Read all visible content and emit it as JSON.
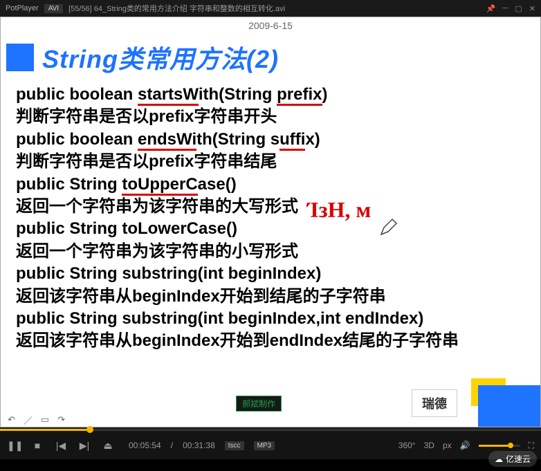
{
  "titlebar": {
    "app": "PotPlayer",
    "format": "AVI",
    "title": "[55/56] 64_String类的常用方法介绍 字符串和整数的相互转化.avi"
  },
  "date": "2009-6-15",
  "slide_title": "String类常用方法(2)",
  "lines": {
    "l1a": "public boolean ",
    "l1b": "startsW",
    "l1c": "ith(String ",
    "l1d": "prefix",
    "l1e": ")",
    "l2": "判断字符串是否以prefix字符串开头",
    "l3a": "public boolean ",
    "l3b": "endsWi",
    "l3c": "th(String s",
    "l3d": "uffi",
    "l3e": "x)",
    "l4": "判断字符串是否以prefix字符串结尾",
    "l5a": "public String ",
    "l5b": "toUpperC",
    "l5c": "ase()",
    "l6": "返回一个字符串为该字符串的大写形式",
    "l7": "public String toLowerCase()",
    "l8": "返回一个字符串为该字符串的小写形式",
    "l9": "public String substring(int beginIndex)",
    "l10": "返回该字符串从beginIndex开始到结尾的子字符串",
    "l11": "public String substring(int beginIndex,int endIndex)",
    "l12": "返回该字符串从beginIndex开始到endIndex结尾的子字符串"
  },
  "annotation": "ΊзΗ, м",
  "credit": "郝斌制作",
  "brand": "瑞德",
  "controls": {
    "play": "❚❚",
    "stop": "■",
    "prev": "|◀",
    "next": "▶|",
    "eject": "⏏",
    "cur": "00:05:54",
    "dur": "00:31:38",
    "codec": "tscc",
    "audio": "MP3",
    "r360": "360°",
    "r3d": "3D",
    "rpx": "px",
    "rfs": "⛶"
  },
  "toolbar": {
    "back": "↶",
    "pen": "／",
    "rect": "▭",
    "fwd": "↷"
  },
  "logo": "亿速云"
}
